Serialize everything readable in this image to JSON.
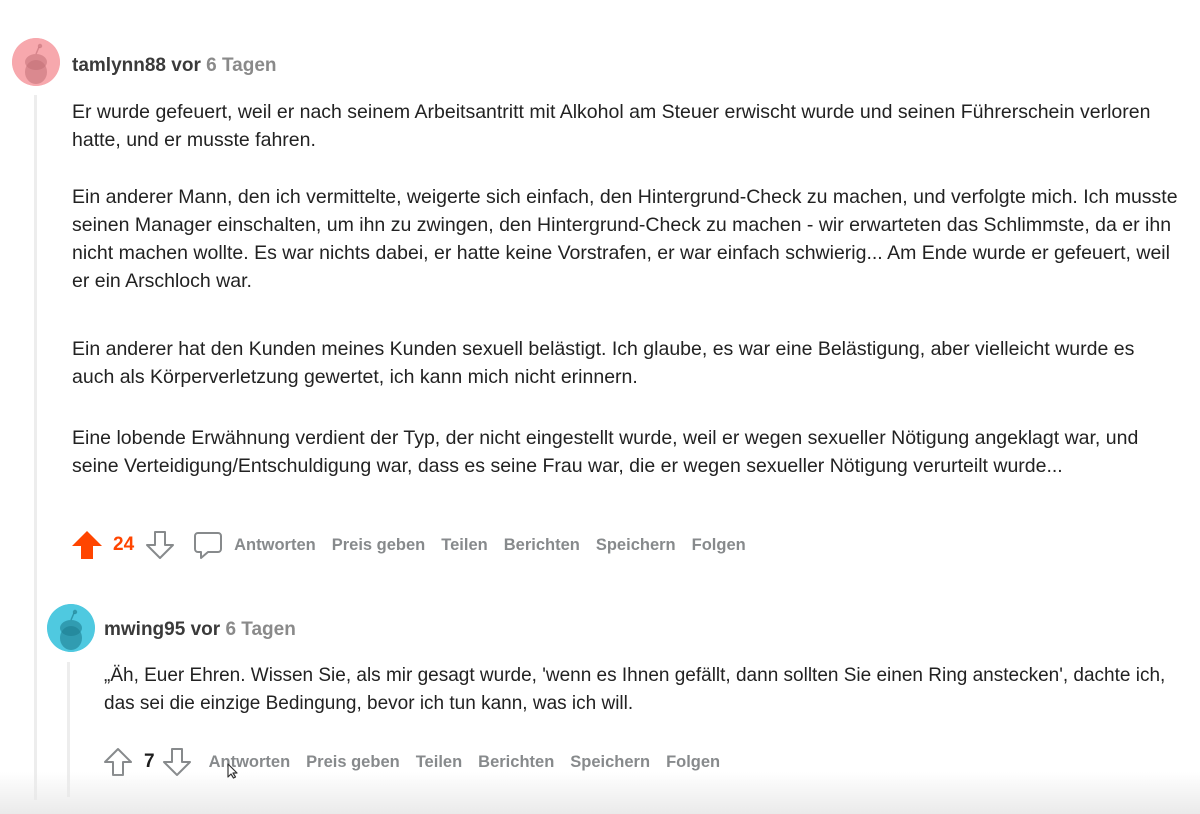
{
  "comments": [
    {
      "username": "tamlynn88",
      "connector": "vor",
      "time": "6 Tagen",
      "avatar_color": "#f7a8ad",
      "paragraphs": [
        "Er wurde gefeuert, weil er nach seinem Arbeitsantritt mit Alkohol am Steuer erwischt wurde und seinen Führerschein verloren hatte, und er musste fahren.",
        "Ein anderer Mann, den ich vermittelte, weigerte sich einfach, den Hintergrund-Check zu machen, und verfolgte mich. Ich musste seinen Manager einschalten, um ihn zu zwingen, den Hintergrund-Check zu machen - wir erwarteten das Schlimmste, da er ihn nicht machen wollte. Es war nichts dabei, er hatte keine Vorstrafen, er war einfach schwierig... Am Ende wurde er gefeuert, weil er ein Arschloch war.",
        "Ein anderer hat den Kunden meines Kunden sexuell belästigt. Ich glaube, es war eine Belästigung, aber vielleicht wurde es auch als Körperverletzung gewertet, ich kann mich nicht erinnern.",
        "Eine lobende Erwähnung verdient der Typ, der nicht eingestellt wurde, weil er wegen sexueller Nötigung angeklagt war, und seine Verteidigung/Entschuldigung war, dass es seine Frau war, die er wegen sexueller Nötigung verurteilt wurde..."
      ],
      "score": "24",
      "upvoted": true,
      "actions": [
        "Antworten",
        "Preis geben",
        "Teilen",
        "Berichten",
        "Speichern",
        "Folgen"
      ]
    },
    {
      "username": "mwing95",
      "connector": "vor",
      "time": "6 Tagen",
      "avatar_color": "#4fc9e0",
      "paragraphs": [
        "„Äh, Euer Ehren. Wissen Sie, als mir gesagt wurde, 'wenn es Ihnen gefällt, dann sollten Sie einen Ring anstecken', dachte ich, das sei die einzige Bedingung, bevor ich tun kann, was ich will."
      ],
      "score": "7",
      "upvoted": false,
      "actions": [
        "Antworten",
        "Preis geben",
        "Teilen",
        "Berichten",
        "Speichern",
        "Folgen"
      ]
    }
  ],
  "colors": {
    "upvote": "#ff4500",
    "action_gray": "#878a8c",
    "thread_line": "#ededed"
  },
  "icons": {
    "upvote": "arrow-up-icon",
    "downvote": "arrow-down-icon",
    "comment": "comment-bubble-icon",
    "avatar": "snoo-avatar-icon"
  }
}
